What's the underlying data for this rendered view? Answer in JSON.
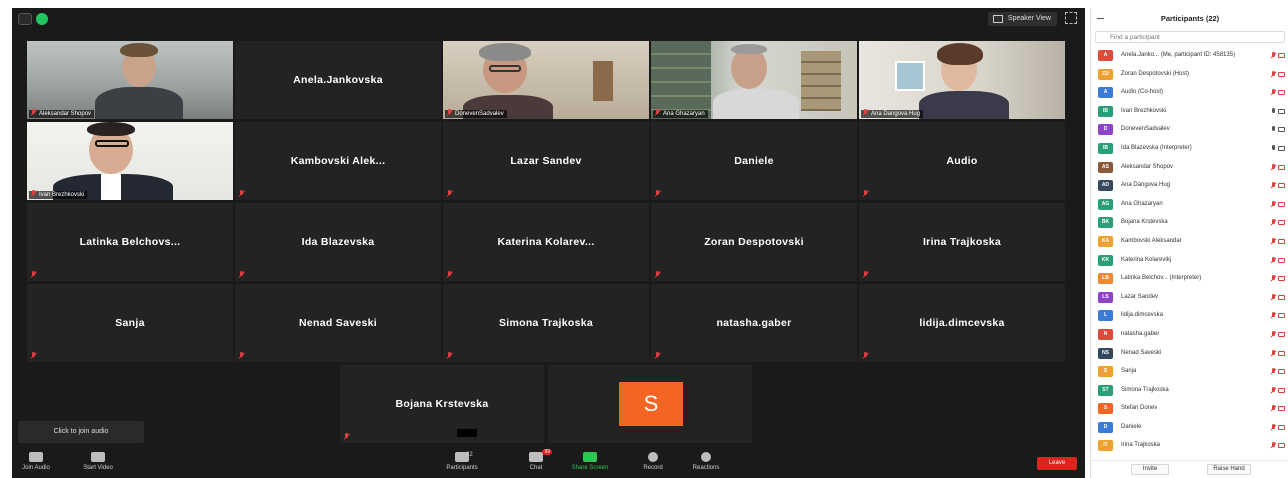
{
  "window": {
    "speaker_view_label": "Speaker View"
  },
  "tiles": [
    {
      "name": "Aleksandar Shopov",
      "video": true
    },
    {
      "name": "Anela.Jankovska",
      "video": false
    },
    {
      "name": "DonevenSadvalev",
      "video": true,
      "active": true
    },
    {
      "name": "Ana Ghazaryan",
      "video": true
    },
    {
      "name": "Ana Dangova Hug",
      "video": true
    },
    {
      "name": "Ivan Brezhkovski",
      "video": true
    },
    {
      "name": "Kambovski  Alek...",
      "video": false
    },
    {
      "name": "Lazar Sandev",
      "video": false
    },
    {
      "name": "Daniele",
      "video": false
    },
    {
      "name": "Audio",
      "video": false
    },
    {
      "name": "Latinka  Belchovs...",
      "video": false
    },
    {
      "name": "Ida Blazevska",
      "video": false
    },
    {
      "name": "Katerina  Kolarev...",
      "video": false
    },
    {
      "name": "Zoran  Despotovski",
      "video": false
    },
    {
      "name": "Irina Trajkoska",
      "video": false
    },
    {
      "name": "Sanja",
      "video": false
    },
    {
      "name": "Nenad Saveski",
      "video": false
    },
    {
      "name": "Simona Trajkoska",
      "video": false
    },
    {
      "name": "natasha.gaber",
      "video": false
    },
    {
      "name": "lidija.dimcevska",
      "video": false
    },
    {
      "name": "Bojana Krstevska",
      "video": false
    }
  ],
  "avatar_tile": {
    "letter": "S",
    "color": "#f26522"
  },
  "join_audio_popup": "Click to join audio",
  "toolbar": {
    "join_audio": "Join Audio",
    "start_video": "Start Video",
    "participants": "Participants",
    "participants_count": "22",
    "chat": "Chat",
    "chat_badge": "99",
    "share_screen": "Share Screen",
    "record": "Record",
    "reactions": "Reactions",
    "leave": "Leave"
  },
  "panel": {
    "title": "Participants (22)",
    "search_placeholder": "Find a participant",
    "participants": [
      {
        "initials": "A",
        "color": "#e04a3a",
        "name": "Anela.Janko... (Me, participant ID: 458135)",
        "mic": "off",
        "cam": "off"
      },
      {
        "initials": "ZD",
        "color": "#f0a030",
        "name": "Zoran Despotovski (Host)",
        "mic": "off",
        "cam": "off"
      },
      {
        "initials": "A",
        "color": "#3a7ad9",
        "name": "Audio (Co-host)",
        "mic": "off",
        "cam": "off"
      },
      {
        "initials": "IB",
        "color": "#27a07a",
        "name": "Ivan Brezhkovski",
        "mic": "on",
        "cam": "on"
      },
      {
        "initials": "D",
        "color": "#8e44c9",
        "name": "DonevenSadvalev",
        "mic": "on",
        "cam": "on"
      },
      {
        "initials": "IB",
        "color": "#27a07a",
        "name": "Ida Blazevska (Interpreter)",
        "mic": "on",
        "cam": "on"
      },
      {
        "initials": "AS",
        "color": "#8a5a3a",
        "name": "Aleksandar Shopov",
        "mic": "off",
        "cam": "off"
      },
      {
        "initials": "AD",
        "color": "#34495e",
        "name": "Ana Dangova Hug",
        "mic": "off",
        "cam": "off"
      },
      {
        "initials": "AG",
        "color": "#27a07a",
        "name": "Ana Ghazaryan",
        "mic": "off",
        "cam": "off"
      },
      {
        "initials": "BK",
        "color": "#27a07a",
        "name": "Bojana Krstevska",
        "mic": "off",
        "cam": "off"
      },
      {
        "initials": "KA",
        "color": "#f0a030",
        "name": "Kambovski Aleksandar",
        "mic": "off",
        "cam": "off"
      },
      {
        "initials": "KK",
        "color": "#27a07a",
        "name": "Katerina Kolarevikj",
        "mic": "off",
        "cam": "off"
      },
      {
        "initials": "LB",
        "color": "#f08a30",
        "name": "Latinka Belchov... (Interpreter)",
        "mic": "off",
        "cam": "off"
      },
      {
        "initials": "LS",
        "color": "#8e44c9",
        "name": "Lazar Sandev",
        "mic": "off",
        "cam": "off"
      },
      {
        "initials": "L",
        "color": "#3a7ad9",
        "name": "lidija.dimcevska",
        "mic": "off",
        "cam": "off"
      },
      {
        "initials": "N",
        "color": "#e04a3a",
        "name": "natasha.gaber",
        "mic": "off",
        "cam": "off"
      },
      {
        "initials": "NS",
        "color": "#34495e",
        "name": "Nenad Saveski",
        "mic": "off",
        "cam": "off"
      },
      {
        "initials": "S",
        "color": "#f0a030",
        "name": "Sanja",
        "mic": "off",
        "cam": "off"
      },
      {
        "initials": "ST",
        "color": "#27a07a",
        "name": "Simona Trajkoska",
        "mic": "off",
        "cam": "off"
      },
      {
        "initials": "S",
        "color": "#f26522",
        "name": "Stefan Donev",
        "mic": "off",
        "cam": "off"
      },
      {
        "initials": "D",
        "color": "#3a7ad9",
        "name": "Daniele",
        "mic": "off",
        "cam": "off"
      },
      {
        "initials": "IT",
        "color": "#f0a030",
        "name": "Irina Trajkoska",
        "mic": "off",
        "cam": "off"
      }
    ],
    "invite_label": "Invite",
    "raise_hand_label": "Raise Hand"
  }
}
